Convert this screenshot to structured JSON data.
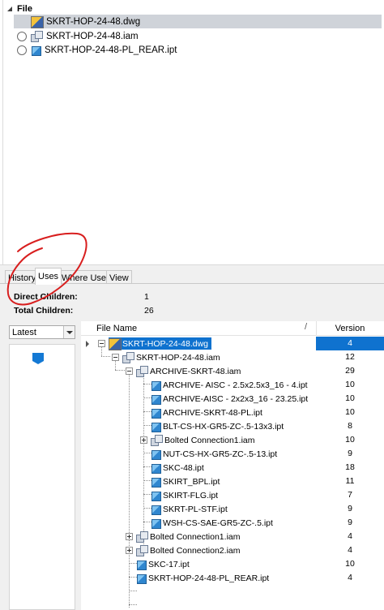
{
  "file_panel": {
    "header": "File",
    "files": [
      {
        "name": "SKRT-HOP-24-48.dwg",
        "type": "dwg",
        "selected": true
      },
      {
        "name": "SKRT-HOP-24-48.iam",
        "type": "iam",
        "selected": false
      },
      {
        "name": "SKRT-HOP-24-48-PL_REAR.ipt",
        "type": "ipt",
        "selected": false
      }
    ]
  },
  "tabs": [
    {
      "label": "History",
      "active": false
    },
    {
      "label": "Uses",
      "active": true
    },
    {
      "label": "Where Used",
      "active": false
    },
    {
      "label": "View",
      "active": false
    }
  ],
  "uses": {
    "direct_children_label": "Direct Children:",
    "direct_children_value": "1",
    "total_children_label": "Total Children:",
    "total_children_value": "26",
    "version_filter": "Latest",
    "columns": {
      "file_name": "File Name",
      "sort_indicator": "/",
      "version": "Version"
    },
    "rows": [
      {
        "name": "SKRT-HOP-24-48.dwg",
        "version": "4",
        "type": "dwg"
      },
      {
        "name": "SKRT-HOP-24-48.iam",
        "version": "12",
        "type": "iam"
      },
      {
        "name": "ARCHIVE-SKRT-48.iam",
        "version": "29",
        "type": "iam"
      },
      {
        "name": "ARCHIVE- AISC - 2.5x2.5x3_16 - 4.ipt",
        "version": "10",
        "type": "ipt"
      },
      {
        "name": "ARCHIVE-AISC - 2x2x3_16 - 23.25.ipt",
        "version": "10",
        "type": "ipt"
      },
      {
        "name": "ARCHIVE-SKRT-48-PL.ipt",
        "version": "10",
        "type": "ipt"
      },
      {
        "name": "BLT-CS-HX-GR5-ZC-.5-13x3.ipt",
        "version": "8",
        "type": "ipt"
      },
      {
        "name": "Bolted Connection1.iam",
        "version": "10",
        "type": "iam"
      },
      {
        "name": "NUT-CS-HX-GR5-ZC-.5-13.ipt",
        "version": "9",
        "type": "ipt"
      },
      {
        "name": "SKC-48.ipt",
        "version": "18",
        "type": "ipt"
      },
      {
        "name": "SKIRT_BPL.ipt",
        "version": "11",
        "type": "ipt"
      },
      {
        "name": "SKIRT-FLG.ipt",
        "version": "7",
        "type": "ipt"
      },
      {
        "name": "SKRT-PL-STF.ipt",
        "version": "9",
        "type": "ipt"
      },
      {
        "name": "WSH-CS-SAE-GR5-ZC-.5.ipt",
        "version": "9",
        "type": "ipt"
      },
      {
        "name": "Bolted Connection1.iam",
        "version": "4",
        "type": "iam"
      },
      {
        "name": "Bolted Connection2.iam",
        "version": "4",
        "type": "iam"
      },
      {
        "name": "SKC-17.ipt",
        "version": "10",
        "type": "ipt"
      },
      {
        "name": "SKRT-HOP-24-48-PL_REAR.ipt",
        "version": "4",
        "type": "ipt"
      }
    ]
  },
  "colors": {
    "selection": "#0f72cf",
    "annotation": "#d81e1e"
  }
}
